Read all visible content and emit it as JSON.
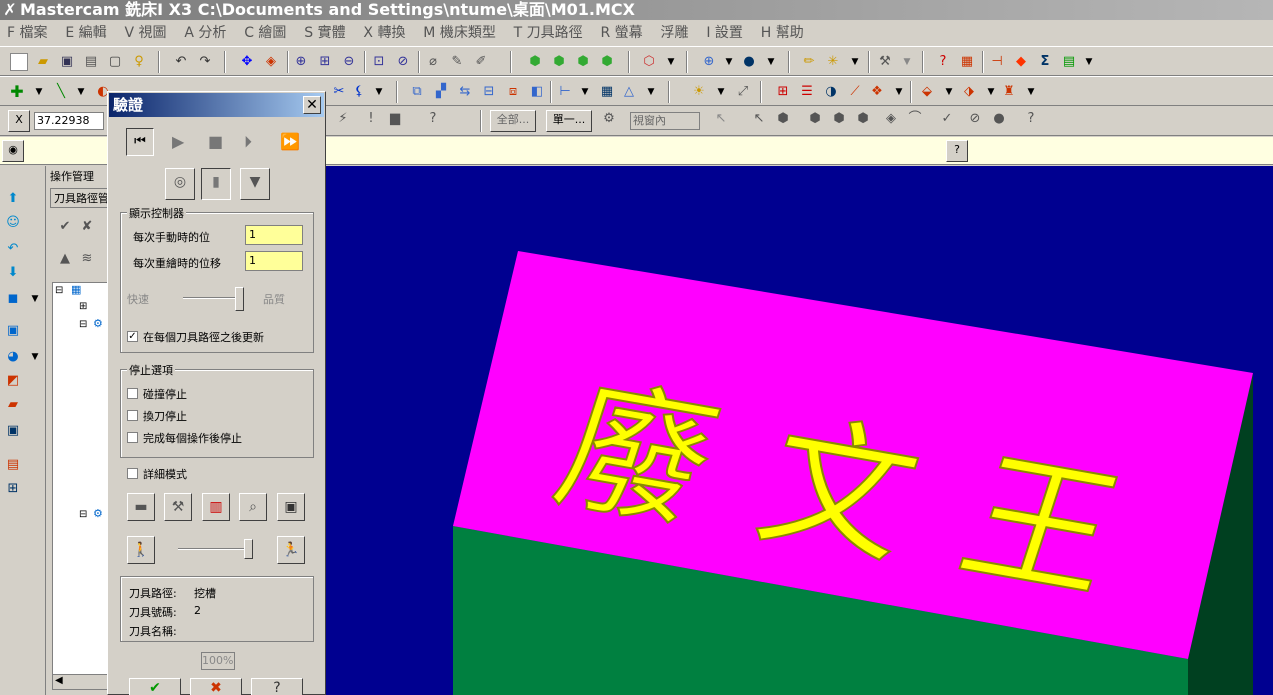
{
  "window": {
    "title": "Mastercam 銑床I X3  C:\\Documents and Settings\\ntume\\桌面\\M01.MCX"
  },
  "menu": [
    {
      "label": "F 檔案"
    },
    {
      "label": "E 編輯"
    },
    {
      "label": "V 視圖"
    },
    {
      "label": "A 分析"
    },
    {
      "label": "C 繪圖"
    },
    {
      "label": "S 實體"
    },
    {
      "label": "X 轉換"
    },
    {
      "label": "M 機床類型"
    },
    {
      "label": "T 刀具路徑"
    },
    {
      "label": "R 螢幕"
    },
    {
      "label": "浮雕"
    },
    {
      "label": "I 設置"
    },
    {
      "label": "H 幫助"
    }
  ],
  "row3": {
    "coord_value": "37.22938",
    "btn_all": "全部...",
    "btn_single": "單一...",
    "view_select": "視窗內"
  },
  "ops_manager": {
    "title": "操作管理",
    "tab": "刀具路徑管"
  },
  "dialog": {
    "title": "驗證",
    "display_group": "顯示控制器",
    "step_label": "每次手動時的位",
    "step_value": "1",
    "redraw_label": "每次重繪時的位移",
    "redraw_value": "1",
    "speed_label": "快速",
    "quality_label": "品質",
    "update_label": "在每個刀具路徑之後更新",
    "stop_group": "停止選項",
    "stop_collision": "碰撞停止",
    "stop_toolchange": "換刀停止",
    "stop_each_op": "完成每個操作後停止",
    "detail_mode": "詳細模式",
    "toolpath_label": "刀具路徑:",
    "toolpath_value": "挖槽",
    "toolnum_label": "刀具號碼:",
    "toolnum_value": "2",
    "toolname_label": "刀具名稱:",
    "percent": "100%"
  },
  "model": {
    "text": "廢文王",
    "colors": {
      "top": "#ff00ff",
      "front": "#008040",
      "side": "#004020",
      "text": "#ffff00",
      "bg": "#000090"
    }
  }
}
